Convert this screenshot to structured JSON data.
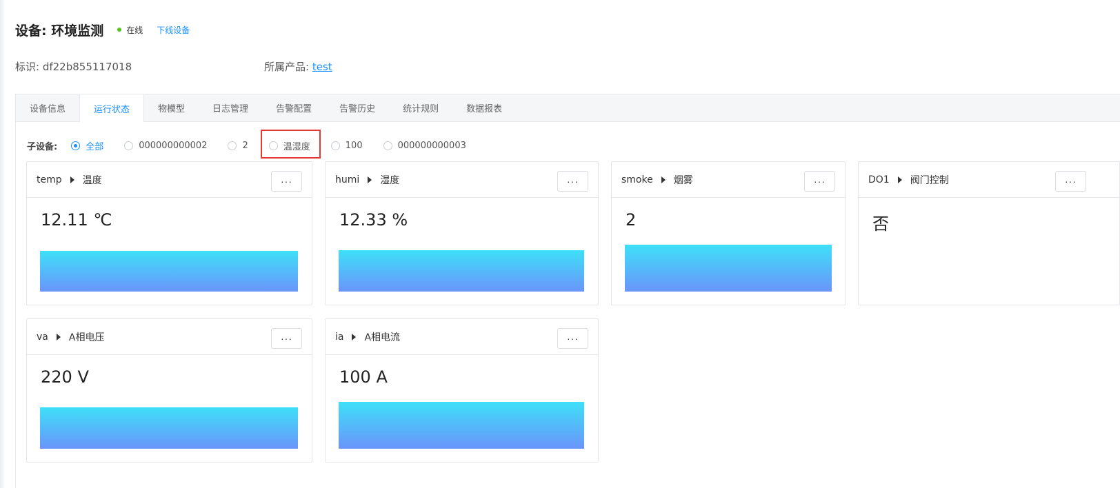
{
  "header": {
    "title": "设备: 环境监测",
    "status": "在线",
    "status_color": "#52c41a",
    "offline_link": "下线设备",
    "link_color": "#1890ff"
  },
  "meta": {
    "id_label": "标识: df22b855117018",
    "product_label": "所属产品: ",
    "product_link": "test"
  },
  "tabs": [
    {
      "label": "设备信息",
      "active": false
    },
    {
      "label": "运行状态",
      "active": true
    },
    {
      "label": "物模型",
      "active": false
    },
    {
      "label": "日志管理",
      "active": false
    },
    {
      "label": "告警配置",
      "active": false
    },
    {
      "label": "告警历史",
      "active": false
    },
    {
      "label": "统计规则",
      "active": false
    },
    {
      "label": "数据报表",
      "active": false
    }
  ],
  "subdevices": {
    "label": "子设备:",
    "options": [
      {
        "label": "全部",
        "checked": true
      },
      {
        "label": "000000000002",
        "checked": false
      },
      {
        "label": "2",
        "checked": false
      },
      {
        "label": "温湿度",
        "checked": false
      },
      {
        "label": "100",
        "checked": false
      },
      {
        "label": "000000000003",
        "checked": false
      }
    ]
  },
  "cards": [
    {
      "key": "temp",
      "name": "温度",
      "value": "12.11 ℃",
      "more_icon": "ellipsis-icon"
    },
    {
      "key": "humi",
      "name": "湿度",
      "value": "12.33 %",
      "more_icon": "ellipsis-icon"
    },
    {
      "key": "smoke",
      "name": "烟雾",
      "value": "2",
      "more_icon": "ellipsis-icon"
    },
    {
      "key": "DO1",
      "name": "阀门控制",
      "value": "否",
      "more_icon": "ellipsis-icon"
    },
    {
      "key": "va",
      "name": "A相电压",
      "value": "220 V",
      "more_icon": "ellipsis-icon"
    },
    {
      "key": "ia",
      "name": "A相电流",
      "value": "100 A",
      "more_icon": "ellipsis-icon"
    }
  ],
  "more_label": "···",
  "colors": {
    "accent": "#1890ff",
    "bar_top": "#3ee0f8",
    "bar_bottom": "#6a94fb",
    "highlight": "#e53935"
  }
}
